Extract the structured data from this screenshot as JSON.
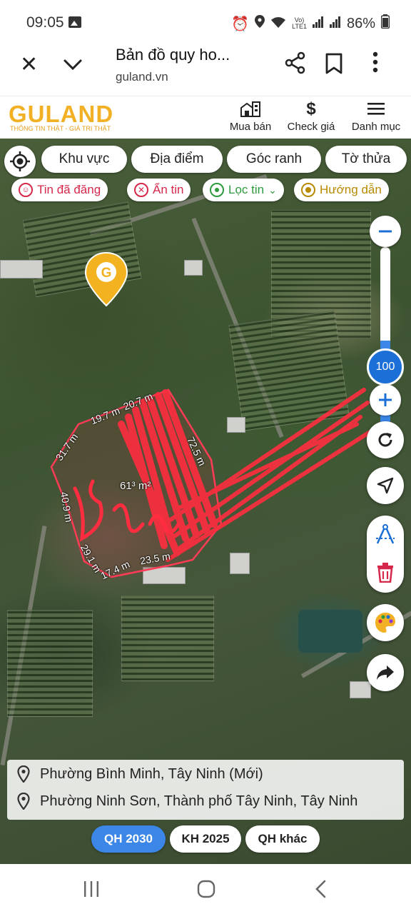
{
  "status_bar": {
    "time": "09:05",
    "battery": "86%",
    "icons": [
      "image-icon",
      "alarm-icon",
      "location-icon",
      "wifi-icon",
      "volte-icon",
      "signal-icon",
      "signal-icon",
      "battery-icon"
    ]
  },
  "browser": {
    "title": "Bản đồ quy ho...",
    "url": "guland.vn"
  },
  "site_header": {
    "logo": "GULAND",
    "tagline": "THÔNG TIN THẬT - GIÁ TRỊ THẬT",
    "nav": [
      {
        "label": "Mua bán",
        "icon": "buildings-icon"
      },
      {
        "label": "Check giá",
        "icon": "dollar-icon"
      },
      {
        "label": "Danh mục",
        "icon": "menu-icon"
      }
    ]
  },
  "map": {
    "filter_chips": [
      "Khu vực",
      "Địa điểm",
      "Góc ranh",
      "Tờ thửa"
    ],
    "action_chips": [
      "Tin đã đăng",
      "Ẩn tin",
      "Lọc tin",
      "Hướng dẫn"
    ],
    "zoom_level": "100",
    "zoom_fill_fraction": 0.55,
    "plot": {
      "area": "61³ m²",
      "edges": [
        "19.7 m",
        "20.7 m",
        "72.5 m",
        "31.7 m",
        "40.9 m",
        "29.1 m",
        "17.4 m",
        "23.5 m"
      ],
      "handwriting": "Bán"
    },
    "colors": {
      "accent_blue": "#1b6fd6",
      "plot_red": "#e0263a",
      "brand_gold": "#f2b124",
      "chip_red": "#d6284b",
      "chip_green": "#2e9a3e",
      "chip_gold": "#b88a00"
    }
  },
  "address": {
    "line1": "Phường Bình Minh, Tây Ninh (Mới)",
    "line2": "Phường Ninh Sơn, Thành phố Tây Ninh, Tây Ninh"
  },
  "plan_tabs": [
    {
      "label": "QH 2030",
      "active": true
    },
    {
      "label": "KH 2025",
      "active": false
    },
    {
      "label": "QH khác",
      "active": false
    }
  ]
}
